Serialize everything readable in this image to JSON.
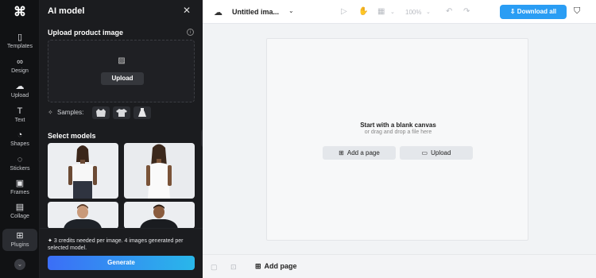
{
  "rail": {
    "items": [
      {
        "label": "Templates",
        "icon": "templates-icon"
      },
      {
        "label": "Design",
        "icon": "design-icon"
      },
      {
        "label": "Upload",
        "icon": "upload-icon"
      },
      {
        "label": "Text",
        "icon": "text-icon"
      },
      {
        "label": "Shapes",
        "icon": "shapes-icon"
      },
      {
        "label": "Stickers",
        "icon": "stickers-icon"
      },
      {
        "label": "Frames",
        "icon": "frames-icon"
      },
      {
        "label": "Collage",
        "icon": "collage-icon"
      },
      {
        "label": "Plugins",
        "icon": "plugins-icon"
      }
    ]
  },
  "panel": {
    "title": "AI model",
    "upload_label": "Upload product image",
    "upload_button": "Upload",
    "samples_label": "Samples:",
    "select_models_label": "Select models",
    "credits_text": "3 credits needed per image. 4 images generated per selected model.",
    "generate_button": "Generate"
  },
  "topbar": {
    "doc_title": "Untitled ima...",
    "zoom": "100%",
    "download_button": "Download all"
  },
  "canvas": {
    "blank_title": "Start with a blank canvas",
    "blank_sub": "or drag and drop a file here",
    "add_page_button": "Add a page",
    "upload_button": "Upload"
  },
  "bottombar": {
    "add_page": "Add page"
  },
  "colors": {
    "accent": "#2a9df4",
    "panel_bg": "#1b1c1f",
    "rail_bg": "#111214"
  }
}
